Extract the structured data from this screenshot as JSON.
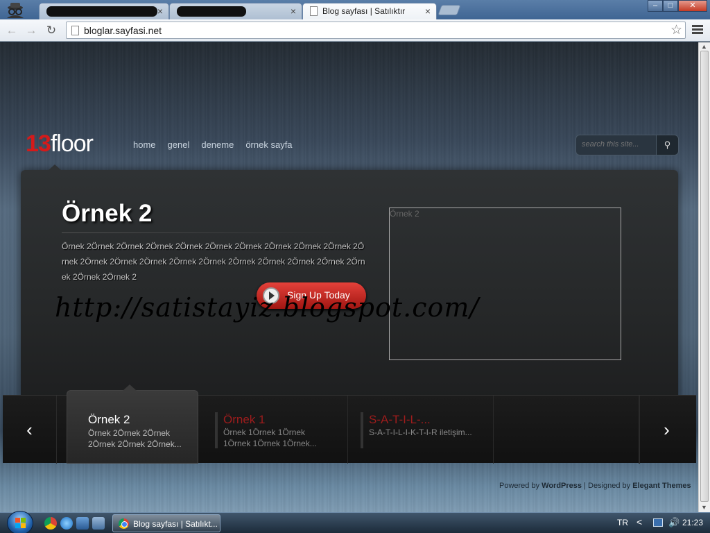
{
  "browser": {
    "tabs": [
      {
        "title": "",
        "redacted": true
      },
      {
        "title": "",
        "redacted": true
      },
      {
        "title": "Blog sayfası | Satılıktır",
        "active": true
      }
    ],
    "close_glyph": "×",
    "url": "bloglar.sayfasi.net",
    "window_buttons": {
      "minimize": "–",
      "maximize": "□",
      "close": "✕"
    },
    "nav": {
      "back": "←",
      "forward": "→",
      "reload": "↻",
      "star": "☆"
    }
  },
  "site": {
    "logo_number": "13",
    "logo_text": "floor",
    "nav": [
      "home",
      "genel",
      "deneme",
      "örnek sayfa"
    ],
    "search_placeholder": "search this site...",
    "search_icon": "⚲"
  },
  "slide": {
    "title": "Örnek 2",
    "text": "Örnek 2Örnek 2Örnek 2Örnek 2Örnek 2Örnek 2Örnek 2Örnek 2Örnek 2Örnek 2Örnek 2Örnek 2Örnek 2Örnek 2Örnek 2Örnek 2Örnek 2Örnek 2Örnek 2Örnek 2Örnek 2Örnek 2Örnek 2",
    "cta_label": "Sign Up Today",
    "image_alt": "Örnek 2"
  },
  "watermark": "http://satistayiz.blogspot.com/",
  "thumbnails": {
    "prev": "‹",
    "next": "›",
    "items": [
      {
        "title": "Örnek 2",
        "excerpt": "Örnek 2Örnek 2Örnek 2Örnek 2Örnek 2Örnek...",
        "active": true
      },
      {
        "title": "Örnek 1",
        "excerpt": "Örnek 1Örnek 1Örnek 1Örnek 1Örnek 1Örnek...",
        "active": false
      },
      {
        "title": "S-A-T-I-L-...",
        "excerpt": "S-A-T-I-L-I-K-T-I-R iletişim...",
        "active": false
      }
    ]
  },
  "footer": {
    "powered_prefix": "Powered by",
    "powered_link": "WordPress",
    "separator": "|",
    "designed_prefix": "Designed by",
    "designed_link": "Elegant Themes"
  },
  "taskbar": {
    "window_label": "Blog sayfası | Satılıkt...",
    "language": "TR",
    "tray_chevron": "<",
    "volume_icon": "🔊",
    "time": "21:23"
  },
  "colors": {
    "accent_red": "#d41a1a",
    "cta_red": "#c9261f",
    "inactive_thumb_title": "#9e1c1c"
  }
}
